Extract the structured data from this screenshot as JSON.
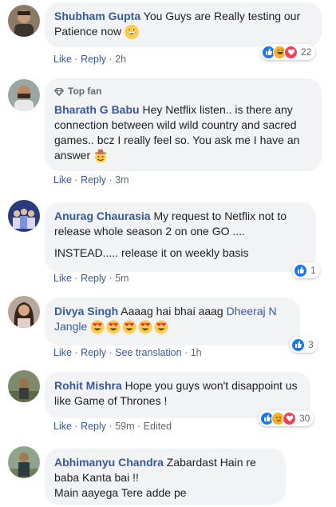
{
  "comments": [
    {
      "author": "Shubham Gupta",
      "text": "You Guys are Really testing our Patience now",
      "actions": {
        "like": "Like",
        "reply": "Reply",
        "time": "2h"
      },
      "reaction_count": "22",
      "reactions": [
        "like",
        "haha",
        "love"
      ]
    },
    {
      "badge": "Top fan",
      "author": "Bharath G Babu",
      "text": "Hey Netflix listen.. is there any connection between wild wild country and sacred games.. bcz I really feel so. You ask me I have an answer",
      "actions": {
        "like": "Like",
        "reply": "Reply",
        "time": "3m"
      }
    },
    {
      "author": "Anurag Chaurasia",
      "text": "My request to Netflix not to release whole season 2 on one GO ....",
      "text2": "INSTEAD..... release it on weekly basis",
      "actions": {
        "like": "Like",
        "reply": "Reply",
        "time": "5m"
      },
      "reaction_count": "1",
      "reactions": [
        "like"
      ]
    },
    {
      "author": "Divya Singh",
      "text": "Aaaag hai bhai aaag",
      "tag": "Dheeraj N Jangle",
      "actions": {
        "like": "Like",
        "reply": "Reply",
        "translate": "See translation",
        "time": "1h"
      },
      "reaction_count": "3",
      "reactions": [
        "like"
      ]
    },
    {
      "author": "Rohit Mishra",
      "text": "Hope you guys won't disappoint us like Game of Thrones !",
      "actions": {
        "like": "Like",
        "reply": "Reply",
        "time": "59m",
        "edited": "Edited"
      },
      "reaction_count": "30",
      "reactions": [
        "like",
        "sad",
        "love"
      ]
    },
    {
      "author": "Abhimanyu Chandra",
      "text": "Zabardast Hain re baba Kanta bai !!",
      "text2": "Main aayega Tere adde pe"
    }
  ],
  "colors": {
    "link": "#385898",
    "bubble": "#f2f3f5",
    "meta": "#606770",
    "like": "#1877f2",
    "love": "#f33e58",
    "haha": "#f7b125"
  },
  "icons": {
    "topfan": "diamond-icon",
    "like": "thumbs-up-icon",
    "love": "heart-icon",
    "haha": "laughing-face-icon",
    "sad": "crying-face-icon",
    "grin": "grinning-face-emoji",
    "cowboy": "cowboy-face-emoji",
    "heart_eyes": "heart-eyes-emoji"
  }
}
